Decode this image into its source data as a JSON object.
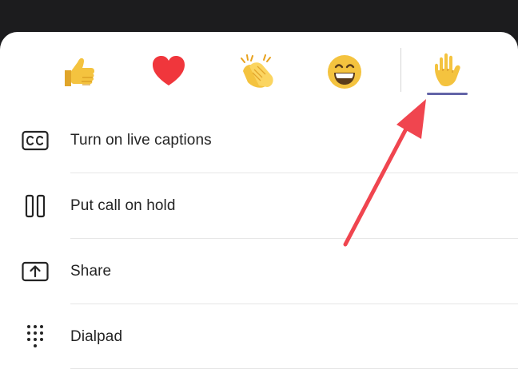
{
  "reactions": [
    {
      "name": "like",
      "icon": "thumbs-up-icon"
    },
    {
      "name": "heart",
      "icon": "heart-icon"
    },
    {
      "name": "applause",
      "icon": "clapping-hands-icon"
    },
    {
      "name": "laugh",
      "icon": "laughing-face-icon"
    },
    {
      "name": "raise-hand",
      "icon": "raised-hand-icon",
      "selected": true
    }
  ],
  "menu": {
    "captions": {
      "label": "Turn on live captions",
      "icon": "closed-captions-icon"
    },
    "hold": {
      "label": "Put call on hold",
      "icon": "pause-icon"
    },
    "share": {
      "label": "Share",
      "icon": "share-screen-icon"
    },
    "dialpad": {
      "label": "Dialpad",
      "icon": "dialpad-icon"
    }
  },
  "colors": {
    "accent": "#6264a7",
    "annotation_arrow": "#f0454f",
    "thumbs": "#f4c33f",
    "heart": "#f0363c",
    "text": "#242424"
  }
}
